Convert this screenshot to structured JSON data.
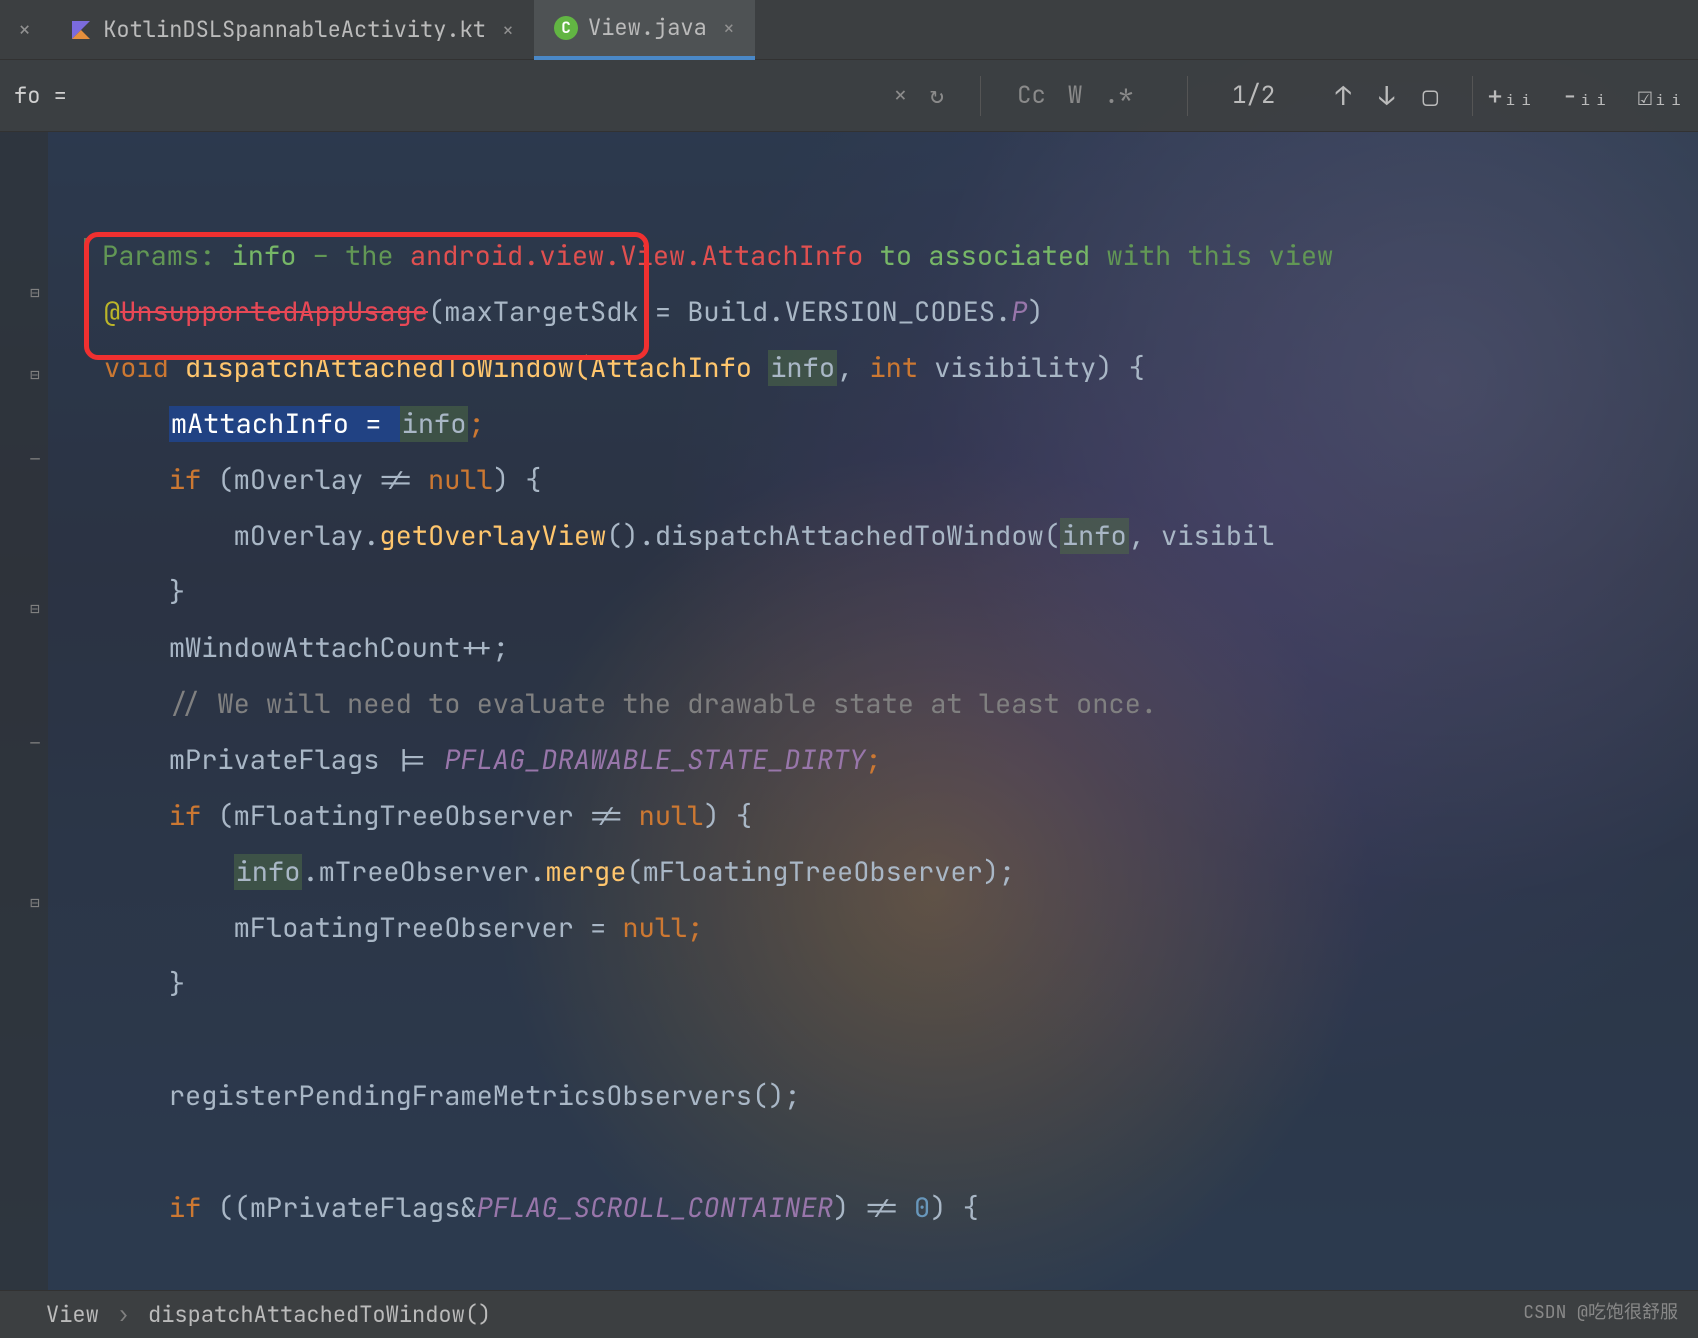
{
  "tabs": {
    "first_close": "×",
    "kotlin": {
      "label": "KotlinDSLSpannableActivity.kt",
      "close": "×"
    },
    "view": {
      "label": "View.java",
      "close": "×"
    }
  },
  "find": {
    "prefix": "fo =",
    "close": "×",
    "reset": "↻",
    "cc": "Cc",
    "word": "W",
    "regex": ".*",
    "count": "1/2",
    "up": "↑",
    "down": "↓",
    "select_all": "▢",
    "add": "+ᵢᵢ",
    "remove": "−ᵢᵢ",
    "check": "☑ᵢᵢ"
  },
  "code": {
    "doc_prefix": "Params: ",
    "doc_info": "info",
    "doc_dash": " – the ",
    "doc_link": "android.view.View.AttachInfo",
    "doc_assoc": " to associated",
    "doc_with": " with this view",
    "anno_at": "@",
    "anno_name": "UnsupportedAppUsage",
    "anno_args1": "(maxTargetSdk = Build.VERSION_CODES.",
    "anno_p": "P",
    "anno_args2": ")",
    "sig_void": "void",
    "sig_name": " dispatchAttachedToWindow(AttachInfo ",
    "sig_info": "info",
    "sig_comma": ", ",
    "sig_int": "int",
    "sig_vis": " visibility) {",
    "asn_field": "mAttachInfo",
    "asn_eq": " = ",
    "asn_info": "info",
    "asn_semi": ";",
    "if1": "if",
    "if1_cond": " (mOverlay != ",
    "null": "null",
    "if1_end": ") {",
    "ov_line1": "mOverlay.",
    "ov_method": "getOverlayView",
    "ov_line2": "().dispatchAttachedToWindow(",
    "ov_info": "info",
    "ov_line3": ", visibil",
    "brace_close": "}",
    "wac": "mWindowAttachCount++;",
    "comment": "// We will need to evaluate the drawable state at least once.",
    "pf_line1": "mPrivateFlags |= ",
    "pf_const": "PFLAG_DRAWABLE_STATE_DIRTY",
    "pf_semi": ";",
    "if2": "if",
    "if2_cond": " (mFloatingTreeObserver != ",
    "if2_end": ") {",
    "mrg1": "info",
    "mrg2": ".mTreeObserver.",
    "mrg_method": "merge",
    "mrg3": "(mFloatingTreeObserver);",
    "fto": "mFloatingTreeObserver = ",
    "fto_semi": ";",
    "reg": "registerPendingFrameMetricsObservers();",
    "if3": "if",
    "if3_cond1": " ((mPrivateFlags&",
    "if3_const": "PFLAG_SCROLL_CONTAINER",
    "if3_cond2": ") != ",
    "if3_zero": "0",
    "if3_end": ") {"
  },
  "breadcrumb": {
    "view": "View",
    "sep": "›",
    "method": "dispatchAttachedToWindow()"
  },
  "watermark": "CSDN @吃饱很舒服"
}
